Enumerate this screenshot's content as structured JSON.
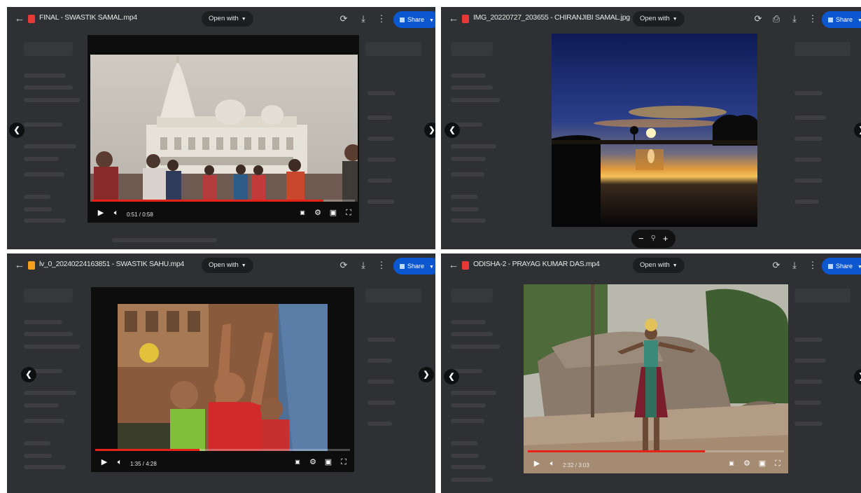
{
  "panes": [
    {
      "file_name": "FINAL - SWASTIK SAMAL.mp4",
      "file_icon_color": "#e53935",
      "open_with": "Open with",
      "share": "Share",
      "player": {
        "time": "0:51 / 0:58",
        "progress": 0.88
      }
    },
    {
      "file_name": "IMG_20220727_203655 - CHIRANJIBI SAMAL.jpg",
      "file_icon_color": "#e53935",
      "open_with": "Open with",
      "share": "Share",
      "zoom": {
        "minus": "−",
        "magnifier": "⚲",
        "plus": "+"
      }
    },
    {
      "file_name": "lv_0_20240224163851 - SWASTIK SAHU.mp4",
      "file_icon_color": "#f4a01c",
      "open_with": "Open with",
      "share": "Share",
      "player": {
        "time": "1:35 / 4:28",
        "progress": 0.41
      }
    },
    {
      "file_name": "ODISHA-2 - PRAYAG KUMAR DAS.mp4",
      "file_icon_color": "#e53935",
      "open_with": "Open with",
      "share": "Share",
      "player": {
        "time": "2:32 / 3:03",
        "progress": 0.69
      }
    }
  ],
  "colors": {
    "accent": "#0b57d0",
    "progress": "#e62117",
    "background": "#2f3033"
  }
}
